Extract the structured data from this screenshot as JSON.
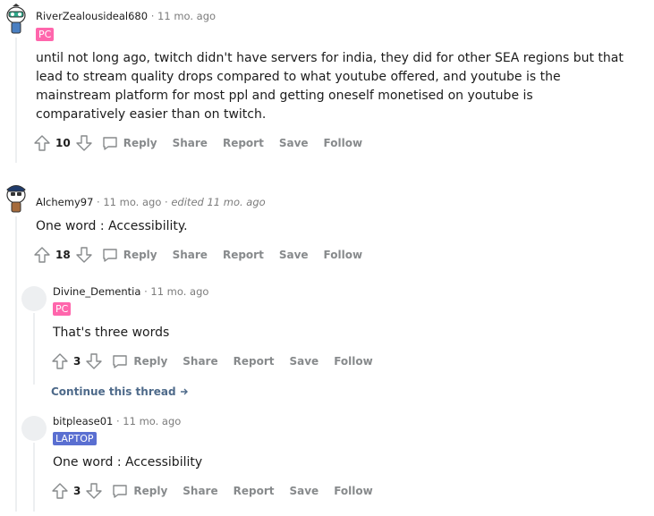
{
  "comments": [
    {
      "username": "RiverZealousideal680",
      "time": "· 11 mo. ago",
      "flair": "PC",
      "body": "until not long ago, twitch didn't have servers for india, they did for other SEA regions but that lead to stream quality drops compared to what youtube offered, and youtube is the mainstream platform for most ppl and getting oneself monetised on youtube is comparatively easier than on twitch.",
      "score": "10",
      "actions": {
        "reply": "Reply",
        "share": "Share",
        "report": "Report",
        "save": "Save",
        "follow": "Follow"
      }
    },
    {
      "username": "Alchemy97",
      "time": "· 11 mo. ago ·",
      "edited": "edited 11 mo. ago",
      "body": "One word : Accessibility.",
      "score": "18",
      "actions": {
        "reply": "Reply",
        "share": "Share",
        "report": "Report",
        "save": "Save",
        "follow": "Follow"
      }
    },
    {
      "username": "Divine_Dementia",
      "time": "· 11 mo. ago",
      "flair": "PC",
      "body": "That's three words",
      "score": "3",
      "actions": {
        "reply": "Reply",
        "share": "Share",
        "report": "Report",
        "save": "Save",
        "follow": "Follow"
      }
    },
    {
      "username": "bitplease01",
      "time": "· 11 mo. ago",
      "flair": "LAPTOP",
      "body": "One word : Accessibility",
      "score": "3",
      "actions": {
        "reply": "Reply",
        "share": "Share",
        "report": "Report",
        "save": "Save",
        "follow": "Follow"
      }
    }
  ],
  "continue_thread": "Continue this thread",
  "colors": {
    "flair_pc": "#ff66ac",
    "flair_laptop": "#5a6fd1",
    "link": "#4e6a8a",
    "muted": "#878a8c"
  },
  "icons": [
    "snoo-avatar-icon",
    "upvote-icon",
    "downvote-icon",
    "comment-icon",
    "arrow-right-icon"
  ]
}
